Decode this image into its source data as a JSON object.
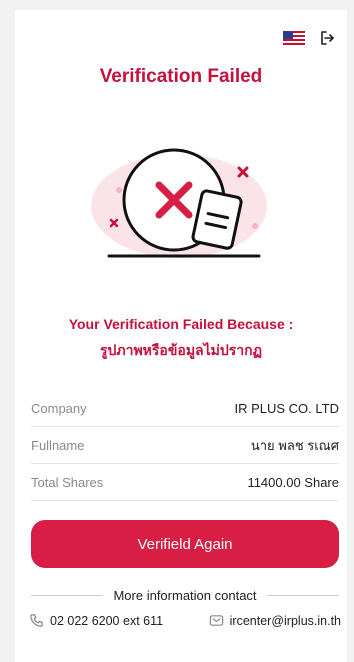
{
  "header": {
    "title": "Verification Failed",
    "language_icon": "us-flag-icon",
    "logout_icon": "logout-icon"
  },
  "reason": {
    "title": "Your Verification Failed Because :",
    "text": "รูปภาพหรือข้อมูลไม่ปรากฏ"
  },
  "details": [
    {
      "label": "Company",
      "value": "IR PLUS CO. LTD"
    },
    {
      "label": "Fullname",
      "value": "นาย พลช รเณศ"
    },
    {
      "label": "Total Shares",
      "value": "11400.00 Share"
    }
  ],
  "actions": {
    "verify_again_label": "Verifield Again"
  },
  "contact": {
    "heading": "More information contact",
    "phone": "02 022 6200 ext 611",
    "email": "ircenter@irplus.in.th"
  },
  "colors": {
    "accent": "#c4123d",
    "button": "#d81e44"
  }
}
